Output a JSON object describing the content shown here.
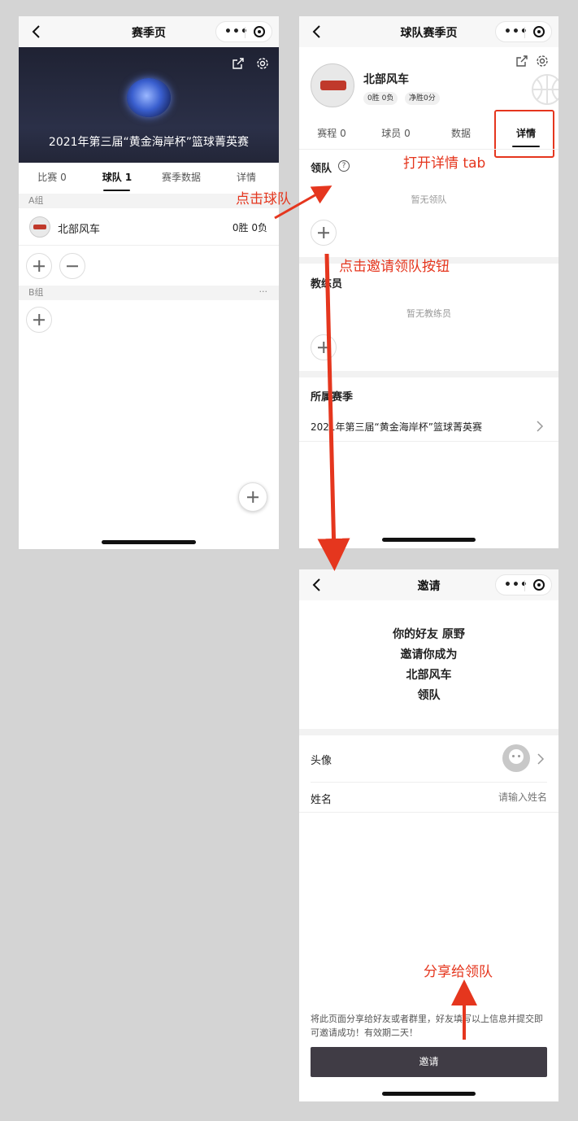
{
  "screen1": {
    "nav_title": "赛季页",
    "banner_title": "2021年第三届“黄金海岸杯”篮球菁英赛",
    "tabs": [
      "比赛 0",
      "球队 1",
      "赛季数据",
      "详情"
    ],
    "group_a": "A组",
    "team_name": "北部风车",
    "team_record": "0胜 0负",
    "group_b": "B组",
    "more": "···"
  },
  "screen2": {
    "nav_title": "球队赛季页",
    "team_name": "北部风车",
    "record_pill": "0胜 0负",
    "net_pill": "净胜0分",
    "tabs": [
      "赛程 0",
      "球员 0",
      "数据",
      "详情"
    ],
    "leader_label": "领队",
    "leader_help": "?",
    "no_leader": "暂无领队",
    "coach_label": "教练员",
    "no_coach": "暂无教练员",
    "season_label": "所属赛季",
    "season_name": "2021年第三届“黄金海岸杯”篮球菁英赛"
  },
  "screen3": {
    "nav_title": "邀请",
    "invite_line1": "你的好友 原野",
    "invite_line2": "邀请你成为",
    "invite_line3": "北部风车",
    "invite_line4": "领队",
    "avatar_label": "头像",
    "name_label": "姓名",
    "name_placeholder": "请输入姓名",
    "notice": "将此页面分享给好友或者群里，好友填写以上信息并提交即可邀请成功！有效期二天！",
    "invite_button": "邀请"
  },
  "annotations": {
    "click_team": "点击球队",
    "open_detail": "打开详情 tab",
    "click_invite": "点击邀请领队按钮",
    "share_leader": "分享给领队"
  },
  "colors": {
    "annotation": "#e5361e",
    "button_dark": "#403c45",
    "background": "#d4d4d4"
  }
}
